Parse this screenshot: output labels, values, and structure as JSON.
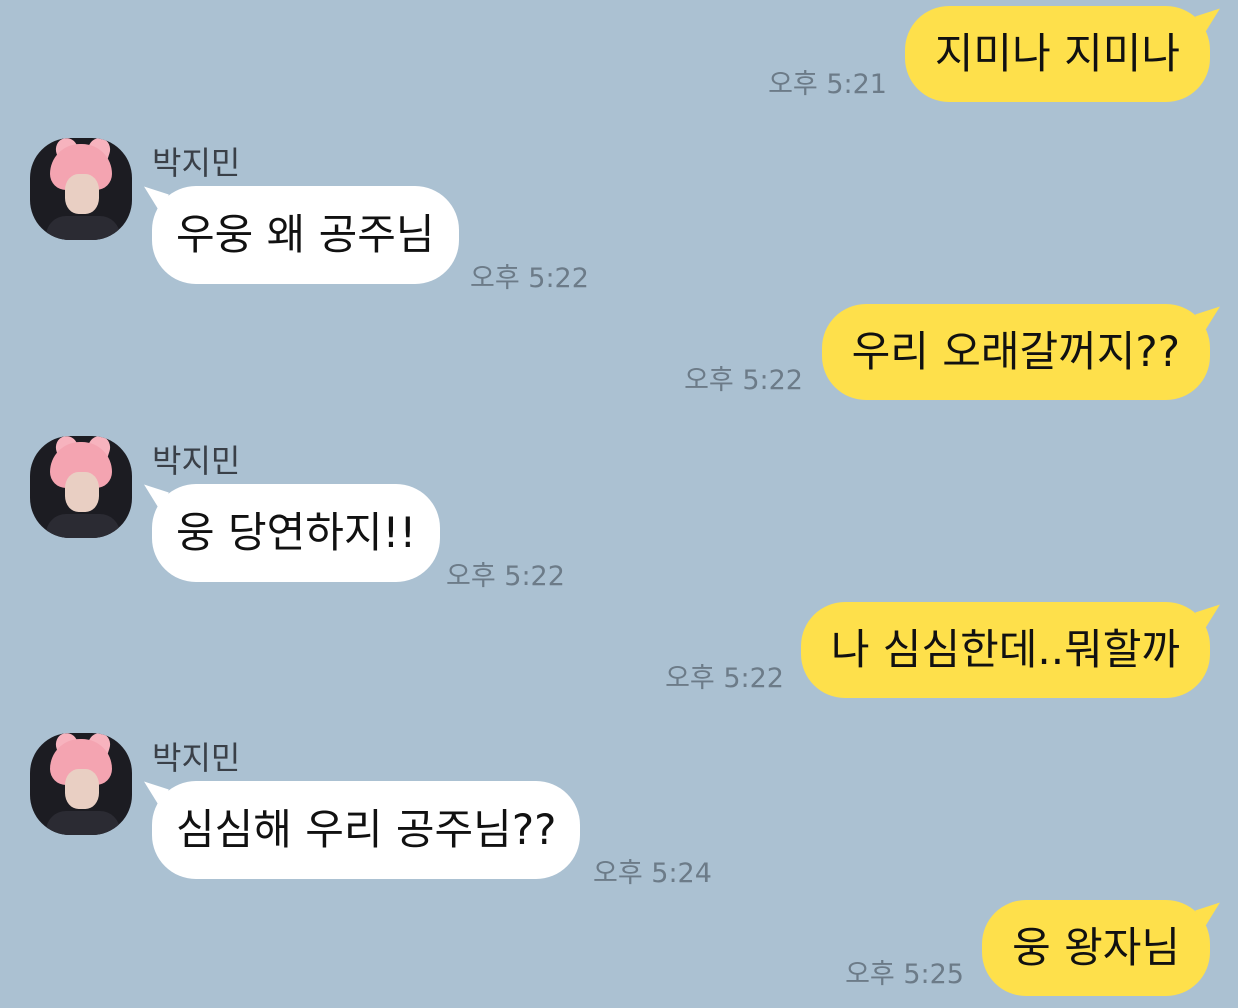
{
  "chat": {
    "messages": [
      {
        "direction": "out",
        "text": "지미나 지미나",
        "time": "오후 5:21"
      },
      {
        "direction": "in",
        "sender": "박지민",
        "text": "우웅 왜 공주님",
        "time": "오후 5:22"
      },
      {
        "direction": "out",
        "text": "우리 오래갈꺼지??",
        "time": "오후 5:22"
      },
      {
        "direction": "in",
        "sender": "박지민",
        "text": "웅 당연하지!!",
        "time": "오후 5:22"
      },
      {
        "direction": "out",
        "text": "나 심심한데..뭐할까",
        "time": "오후 5:22"
      },
      {
        "direction": "in",
        "sender": "박지민",
        "text": "심심해 우리 공주님??",
        "time": "오후 5:24"
      },
      {
        "direction": "out",
        "text": "웅 왕자님",
        "time": "오후 5:25"
      }
    ]
  },
  "colors": {
    "background": "#abc1d2",
    "outgoing_bubble": "#fee04b",
    "incoming_bubble": "#ffffff",
    "timestamp": "#6c7b88"
  }
}
